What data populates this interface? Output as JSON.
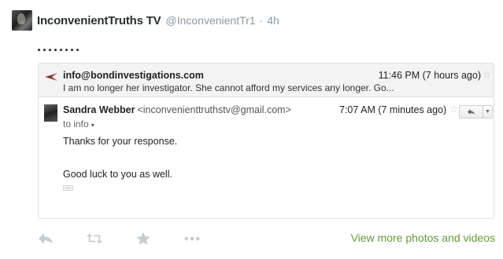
{
  "tweet": {
    "fullname": "InconvenientTruths TV",
    "username": "@InconvenientTr1",
    "separator": "·",
    "time": "4h",
    "text": "........"
  },
  "email_card": {
    "message1": {
      "from": "info@bondinvestigations.com",
      "date": "11:46 PM (7 hours ago)",
      "snippet": "I am no longer her investigator. She cannot afford my services any longer. Go..."
    },
    "message2": {
      "sender_name": "Sandra Webber",
      "sender_email": "<inconvenienttruthstv@gmail.com>",
      "date": "7:07 AM (7 minutes ago)",
      "to": "to info",
      "body_line1": "Thanks for your response.",
      "body_line2": "Good luck to you as well.",
      "trimmed_indicator": "..."
    },
    "icons": {
      "star": "star-icon",
      "reply": "reply-icon",
      "dropdown": "chevron-down-icon"
    }
  },
  "actions": {
    "icons": [
      "reply-icon",
      "retweet-icon",
      "favorite-star-icon",
      "more-dots-icon"
    ],
    "view_more_label": "View more photos and videos"
  },
  "colors": {
    "link_green": "#609c36",
    "muted_gray": "#8899a6",
    "action_icon": "#c5cdd3"
  }
}
